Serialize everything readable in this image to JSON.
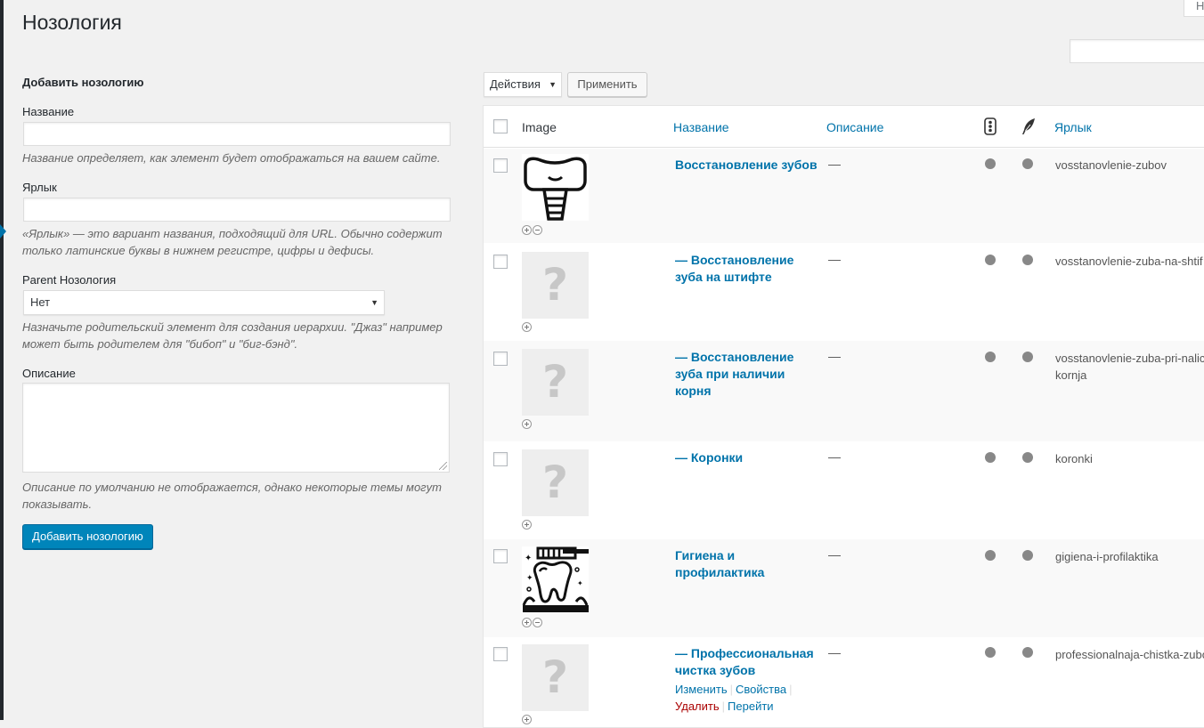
{
  "page": {
    "title": "Нозология",
    "screen_options_label": "Н"
  },
  "form": {
    "heading": "Добавить нозологию",
    "name_label": "Название",
    "name_value": "",
    "name_help": "Название определяет, как элемент будет отображаться на вашем сайте.",
    "slug_label": "Ярлык",
    "slug_value": "",
    "slug_help": "«Ярлык» — это вариант названия, подходящий для URL. Обычно содержит только латинские буквы в нижнем регистре, цифры и дефисы.",
    "parent_label": "Parent Нозология",
    "parent_value": "Нет",
    "parent_help": "Назначьте родительский элемент для создания иерархии. \"Джаз\" например может быть родителем для \"бибоп\" и \"биг-бэнд\".",
    "description_label": "Описание",
    "description_value": "",
    "description_help": "Описание по умолчанию не отображается, однако некоторые темы могут показывать.",
    "submit_label": "Добавить нозологию"
  },
  "bulk": {
    "actions_label": "Действия",
    "apply_label": "Применить"
  },
  "table": {
    "columns": {
      "image": "Image",
      "name": "Название",
      "description": "Описание",
      "slug": "Ярлык"
    },
    "rows": [
      {
        "name": "Восстановление зубов",
        "description": "—",
        "slug": "vosstanovlenie-zubov",
        "image": "tooth-implant-icon",
        "has_image": true
      },
      {
        "name": "— Восстановление зуба на штифте",
        "description": "—",
        "slug": "vosstanovlenie-zuba-na-shtif",
        "image": "placeholder",
        "has_image": false
      },
      {
        "name": "— Восстановление зуба при наличии корня",
        "description": "—",
        "slug": "vosstanovlenie-zuba-pri-nalic kornja",
        "image": "placeholder",
        "has_image": false
      },
      {
        "name": "— Коронки",
        "description": "—",
        "slug": "koronki",
        "image": "placeholder",
        "has_image": false
      },
      {
        "name": "Гигиена и профилактика",
        "description": "—",
        "slug": "gigiena-i-profilaktika",
        "image": "tooth-brushing-icon",
        "has_image": true
      },
      {
        "name": "— Профессиональная чистка зубов",
        "description": "—",
        "slug": "professionalnaja-chistka-zubo",
        "image": "placeholder",
        "has_image": false
      }
    ],
    "row_actions": {
      "edit": "Изменить",
      "quick_edit": "Свойства",
      "delete": "Удалить",
      "view": "Перейти"
    },
    "placeholder_glyph": "?"
  }
}
